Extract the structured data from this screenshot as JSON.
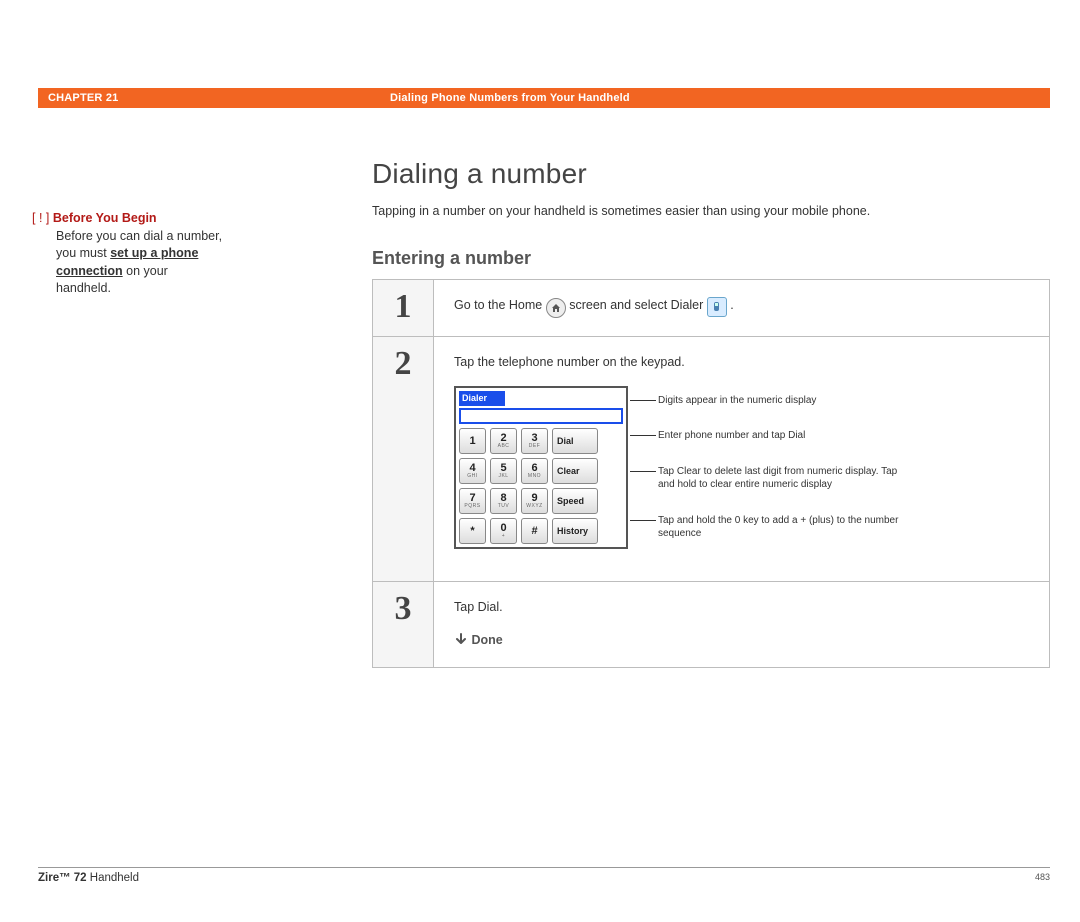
{
  "header": {
    "chapter": "CHAPTER 21",
    "section": "Dialing Phone Numbers from Your Handheld"
  },
  "sidebar": {
    "byb_label": "Before You Begin",
    "text_before": "Before you can dial a number, you must ",
    "link_text": "set up a phone connection",
    "text_after": " on your handheld."
  },
  "main": {
    "title": "Dialing a number",
    "lead": "Tapping in a number on your handheld is sometimes easier than using your mobile phone.",
    "subtitle": "Entering a number",
    "step1_a": "Go to the Home ",
    "step1_b": " screen and select Dialer ",
    "step1_c": ".",
    "step2": "Tap the telephone number on the keypad.",
    "step3": "Tap Dial.",
    "done": "Done"
  },
  "keypad": {
    "title": "Dialer",
    "keys": [
      {
        "main": "1",
        "sub": ""
      },
      {
        "main": "2",
        "sub": "ABC"
      },
      {
        "main": "3",
        "sub": "DEF"
      },
      {
        "main": "Dial",
        "sub": "",
        "action": true
      },
      {
        "main": "4",
        "sub": "GHI"
      },
      {
        "main": "5",
        "sub": "JKL"
      },
      {
        "main": "6",
        "sub": "MNO"
      },
      {
        "main": "Clear",
        "sub": "",
        "action": true
      },
      {
        "main": "7",
        "sub": "PQRS"
      },
      {
        "main": "8",
        "sub": "TUV"
      },
      {
        "main": "9",
        "sub": "WXYZ"
      },
      {
        "main": "Speed",
        "sub": "",
        "action": true
      },
      {
        "main": "*",
        "sub": ""
      },
      {
        "main": "0",
        "sub": "+"
      },
      {
        "main": "#",
        "sub": ""
      },
      {
        "main": "History",
        "sub": "",
        "action": true
      }
    ]
  },
  "callouts": {
    "c1": "Digits appear in the numeric display",
    "c2": "Enter phone number and tap Dial",
    "c3": "Tap Clear to delete last digit from numeric display. Tap and hold to clear entire numeric display",
    "c4": "Tap and hold the 0 key to add a + (plus) to the number sequence"
  },
  "footer": {
    "brand_bold": "Zire™ 72",
    "brand_rest": " Handheld",
    "page": "483"
  },
  "steps": {
    "n1": "1",
    "n2": "2",
    "n3": "3"
  }
}
